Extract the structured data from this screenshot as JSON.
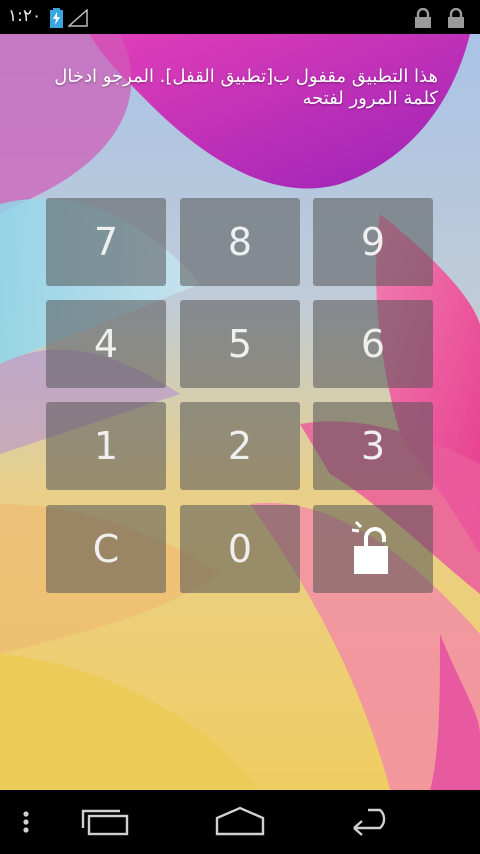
{
  "status_bar": {
    "time": "١:٢٠",
    "icons": [
      "battery-charging-icon",
      "signal-icon",
      "lock-icon",
      "lock-icon"
    ]
  },
  "lock_message": "هذا التطبيق مقفول ب[تطبيق القفل]. المرجو ادخال كلمة المرور لفتحه",
  "keypad": {
    "rows": [
      [
        "7",
        "8",
        "9"
      ],
      [
        "4",
        "5",
        "6"
      ],
      [
        "1",
        "2",
        "3"
      ],
      [
        "C",
        "0",
        "unlock-icon"
      ]
    ]
  },
  "nav_bar": {
    "icons": [
      "menu-dots-icon",
      "recent-apps-icon",
      "home-icon",
      "back-icon"
    ]
  },
  "colors": {
    "key_background": "#555555",
    "key_text": "#efefef",
    "status_bar": "#000000"
  }
}
